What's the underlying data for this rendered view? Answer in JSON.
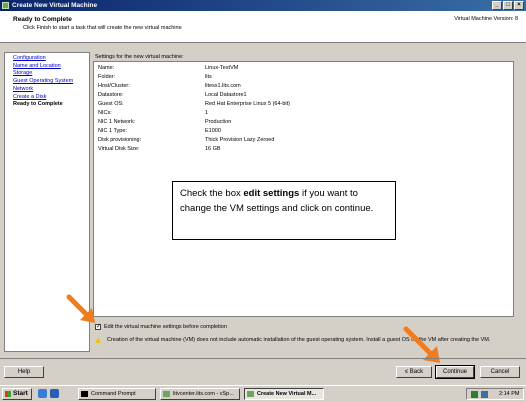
{
  "window": {
    "title": "Create New Virtual Machine",
    "min": "_",
    "max": "□",
    "close": "×"
  },
  "header": {
    "title": "Ready to Complete",
    "subtitle": "Click Finish to start a task that will create the new virtual machine",
    "version": "Virtual Machine Version: 8"
  },
  "nav": [
    {
      "label": "Configuration"
    },
    {
      "label": "Name and Location"
    },
    {
      "label": "Storage"
    },
    {
      "label": "Guest Operating System"
    },
    {
      "label": "Network"
    },
    {
      "label": "Create a Disk"
    },
    {
      "label": "Ready to Complete"
    }
  ],
  "settings": {
    "heading": "Settings for the new virtual machine:",
    "rows": [
      {
        "label": "Name:",
        "value": "Linux-TestVM"
      },
      {
        "label": "Folder:",
        "value": "lits"
      },
      {
        "label": "Host/Cluster:",
        "value": "litesx1.lits.com"
      },
      {
        "label": "Datastore:",
        "value": "Local Datastore1"
      },
      {
        "label": "Guest OS:",
        "value": "Red Hat Enterprise Linux 5 (64-bit)"
      },
      {
        "label": "NICs:",
        "value": "1"
      },
      {
        "label": "NIC 1 Network:",
        "value": "Production"
      },
      {
        "label": "NIC 1 Type:",
        "value": "E1000"
      },
      {
        "label": "Disk provisioning:",
        "value": "Thick Provision Lazy Zeroed"
      },
      {
        "label": "Virtual Disk Size:",
        "value": "16 GB"
      }
    ]
  },
  "callout": {
    "before": "Check the box ",
    "bold": "edit settings",
    "after": " if you want to change the VM settings  and click on continue."
  },
  "checkbox": {
    "label": "Edit the virtual machine settings before completion",
    "checked": true,
    "mark": "✓"
  },
  "warning": {
    "text": "Creation of the virtual machine (VM) does not include automatic installation of the guest operating system. Install a guest OS on the VM after creating the VM."
  },
  "buttons": {
    "help": "Help",
    "back": "≤ Back",
    "continue": "Continue",
    "cancel": "Cancel"
  },
  "taskbar": {
    "start": "Start",
    "tasks": [
      {
        "label": "Command Prompt"
      },
      {
        "label": "litvcenter.lits.com - vSp..."
      },
      {
        "label": "Create New Virtual M..."
      }
    ],
    "clock": "2:14 PM"
  },
  "colors": {
    "arrow": "#f07c1e",
    "link": "#0000cc",
    "titlebar": "#0a246a"
  }
}
